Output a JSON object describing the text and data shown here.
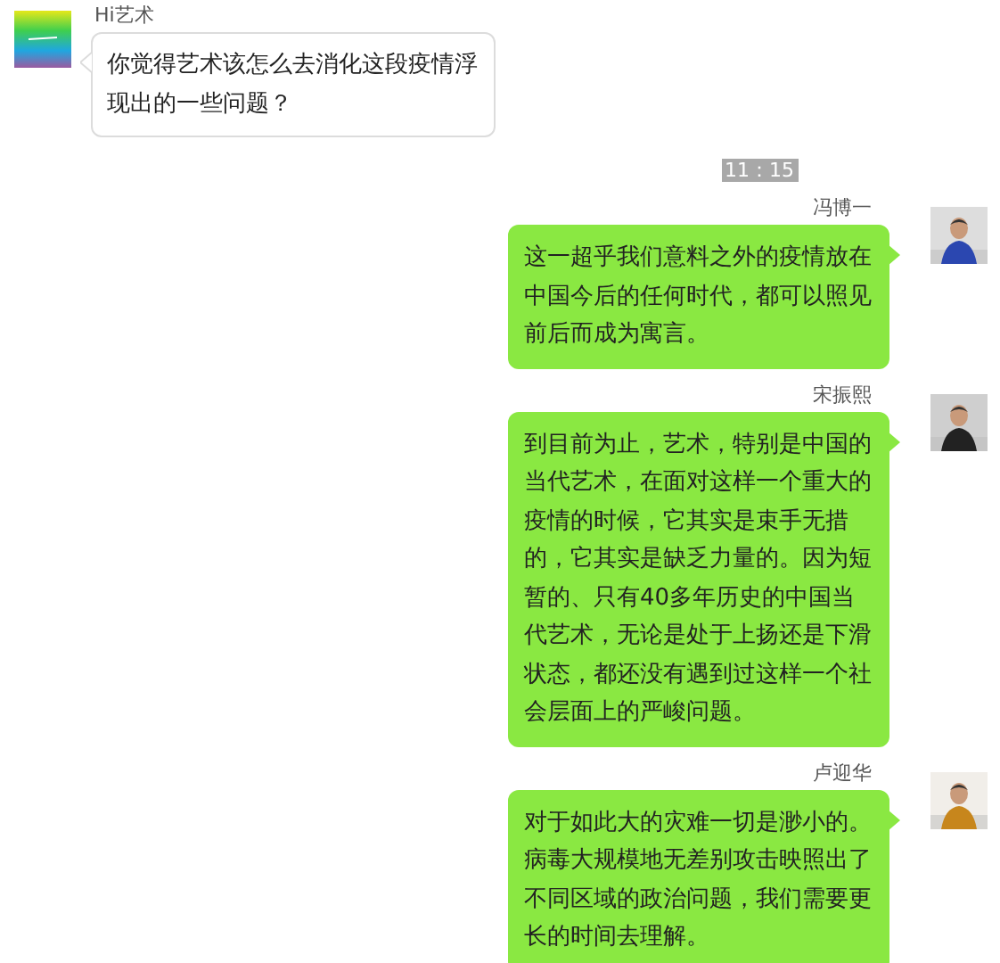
{
  "messages": [
    {
      "kind": "incoming",
      "sender": "Hi艺术",
      "text": "你觉得艺术该怎么去消化这段疫情浮现出的一些问题？"
    },
    {
      "kind": "time",
      "text": "11：15"
    },
    {
      "kind": "outgoing",
      "sender": "冯博一",
      "text": "这一超乎我们意料之外的疫情放在中国今后的任何时代，都可以照见前后而成为寓言。"
    },
    {
      "kind": "outgoing",
      "sender": "宋振熙",
      "text": "到目前为止，艺术，特别是中国的当代艺术，在面对这样一个重大的疫情的时候，它其实是束手无措的，它其实是缺乏力量的。因为短暂的、只有40多年历史的中国当代艺术，无论是处于上扬还是下滑状态，都还没有遇到过这样一个社会层面上的严峻问题。"
    },
    {
      "kind": "outgoing",
      "sender": "卢迎华",
      "text": "对于如此大的灾难一切是渺小的。病毒大规模地无差别攻击映照出了不同区域的政治问题，我们需要更长的时间去理解。"
    }
  ]
}
